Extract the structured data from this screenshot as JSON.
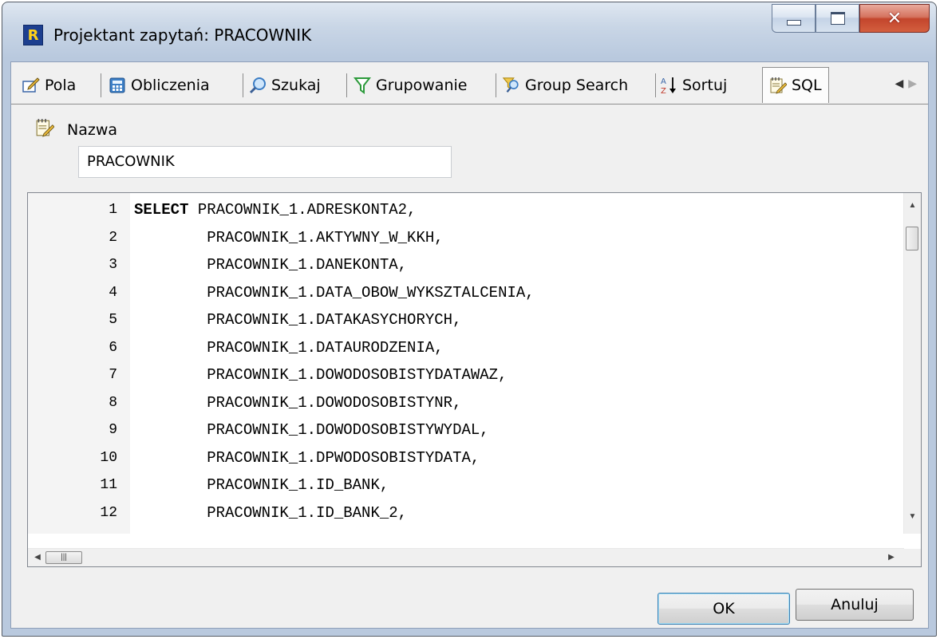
{
  "window": {
    "title": "Projektant zapytań: PRACOWNIK",
    "app_icon_letter": "R",
    "controls": [
      "minimize-icon",
      "maximize-icon",
      "close-icon"
    ]
  },
  "tabs": [
    {
      "label": "Pola",
      "icon": "edit-icon"
    },
    {
      "label": "Obliczenia",
      "icon": "calculator-icon"
    },
    {
      "label": "Szukaj",
      "icon": "search-icon"
    },
    {
      "label": "Grupowanie",
      "icon": "filter-icon"
    },
    {
      "label": "Group Search",
      "icon": "group-search-icon"
    },
    {
      "label": "Sortuj",
      "icon": "sort-az-icon"
    },
    {
      "label": "SQL",
      "icon": "sql-note-icon",
      "active": true
    }
  ],
  "name_field": {
    "label": "Nazwa",
    "value": "PRACOWNIK"
  },
  "editor": {
    "lines": [
      {
        "n": "1",
        "keyword": "SELECT",
        "text": " PRACOWNIK_1.ADRESKONTA2,"
      },
      {
        "n": "2",
        "keyword": "",
        "text": "        PRACOWNIK_1.AKTYWNY_W_KKH,"
      },
      {
        "n": "3",
        "keyword": "",
        "text": "        PRACOWNIK_1.DANEKONTA,"
      },
      {
        "n": "4",
        "keyword": "",
        "text": "        PRACOWNIK_1.DATA_OBOW_WYKSZTALCENIA,"
      },
      {
        "n": "5",
        "keyword": "",
        "text": "        PRACOWNIK_1.DATAKASYCHORYCH,"
      },
      {
        "n": "6",
        "keyword": "",
        "text": "        PRACOWNIK_1.DATAURODZENIA,"
      },
      {
        "n": "7",
        "keyword": "",
        "text": "        PRACOWNIK_1.DOWODOSOBISTYDATAWAZ,"
      },
      {
        "n": "8",
        "keyword": "",
        "text": "        PRACOWNIK_1.DOWODOSOBISTYNR,"
      },
      {
        "n": "9",
        "keyword": "",
        "text": "        PRACOWNIK_1.DOWODOSOBISTYWYDAL,"
      },
      {
        "n": "10",
        "keyword": "",
        "text": "        PRACOWNIK_1.DPWODOSOBISTYDATA,"
      },
      {
        "n": "11",
        "keyword": "",
        "text": "        PRACOWNIK_1.ID_BANK,"
      },
      {
        "n": "12",
        "keyword": "",
        "text": "        PRACOWNIK_1.ID_BANK_2,"
      }
    ]
  },
  "buttons": {
    "ok": "OK",
    "cancel": "Anuluj"
  }
}
